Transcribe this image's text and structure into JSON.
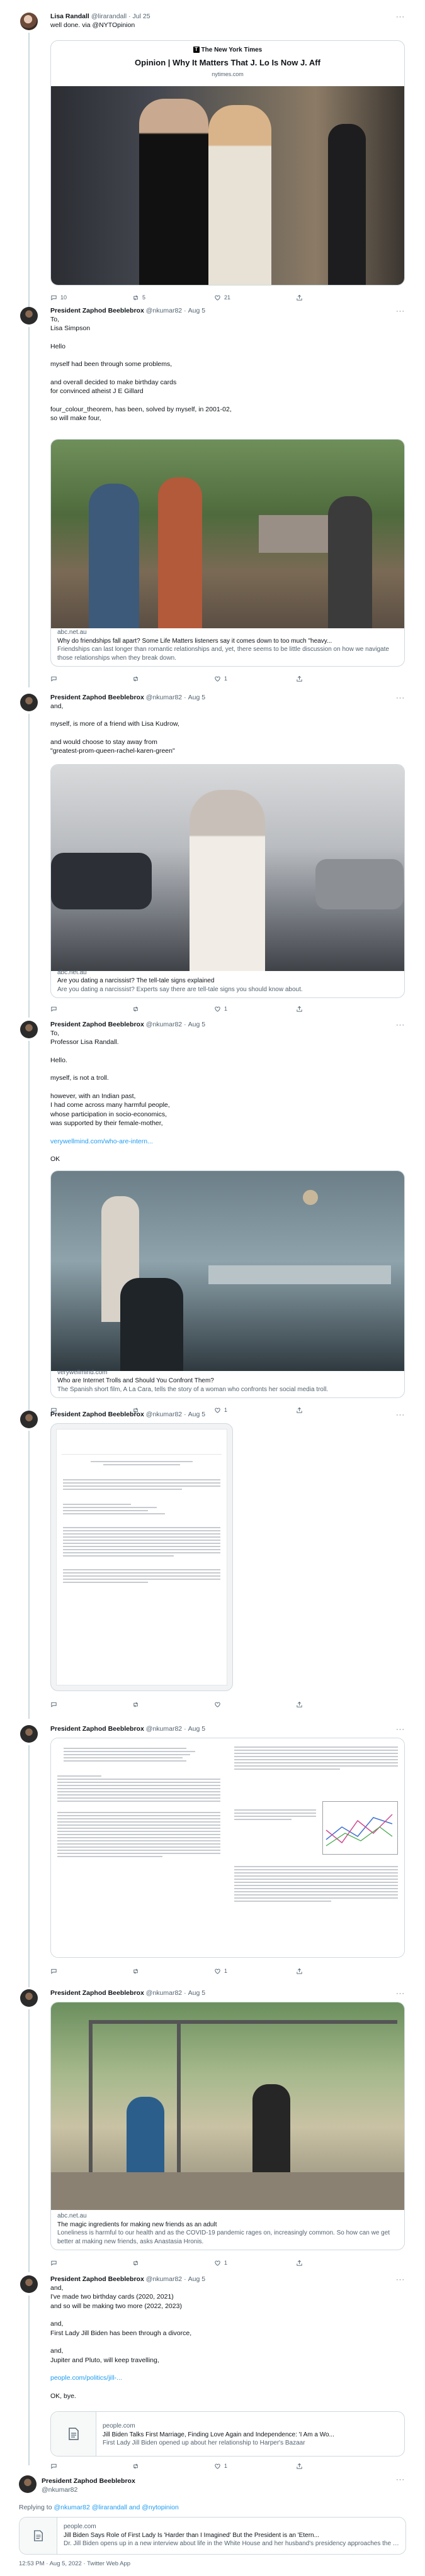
{
  "tweets": [
    {
      "name": "Lisa Randall",
      "handle": "@lirarandall",
      "date": "Jul 25",
      "lines": [
        "well done. via @NYTOpinion"
      ],
      "card": {
        "source": "The New York Times",
        "title": "Opinion | Why It Matters That J. Lo Is Now J. Aff",
        "domain": "nytimes.com"
      },
      "counts": {
        "reply": "10",
        "retweet": "5",
        "like": "21"
      }
    },
    {
      "name": "President Zaphod Beeblebrox",
      "handle": "@nkumar82",
      "date": "Aug 5",
      "lines": [
        "To,",
        "Lisa Simpson",
        "",
        "Hello",
        "",
        "myself had been through some problems,",
        "",
        "and overall decided to make birthday cards",
        "for convinced atheist J E Gillard",
        "",
        "four_colour_theorem, has been, solved by myself, in 2001-02,",
        "so will make four,"
      ],
      "card": {
        "domain": "abc.net.au",
        "title": "Why do friendships fall apart? Some Life Matters listeners say it comes down to too much \"heavy...",
        "desc": "Friendships can last longer than romantic relationships and, yet, there seems to be little discussion on how we navigate those relationships when they break down."
      },
      "counts": {
        "reply": "",
        "retweet": "",
        "like": "1"
      }
    },
    {
      "name": "President Zaphod Beeblebrox",
      "handle": "@nkumar82",
      "date": "Aug 5",
      "lines": [
        "and,",
        "",
        "myself, is more of a friend with Lisa Kudrow,",
        "",
        "and would choose to stay away from",
        "\"greatest-prom-queen-rachel-karen-green\""
      ],
      "card": {
        "domain": "abc.net.au",
        "title": "Are you dating a narcissist? The tell-tale signs explained",
        "desc": "Are you dating a narcissist? Experts say there are tell-tale signs you should know about."
      },
      "counts": {
        "reply": "",
        "retweet": "",
        "like": "1"
      }
    },
    {
      "name": "President Zaphod Beeblebrox",
      "handle": "@nkumar82",
      "date": "Aug 5",
      "lines": [
        "To,",
        "Professor Lisa Randall.",
        "",
        "Hello.",
        "",
        "myself, is not a troll.",
        "",
        "however, with an Indian past,",
        "I had come across many harmful people,",
        "whose participation in socio-economics,",
        "was supported by their female-mother,"
      ],
      "link": "verywellmind.com/who-are-intern...",
      "after": [
        "OK"
      ],
      "card": {
        "domain": "verywellmind.com",
        "title": "Who are Internet Trolls and Should You Confront Them?",
        "desc": "The Spanish short film, A La Cara, tells the story of a woman who confronts her social media troll."
      },
      "counts": {
        "reply": "",
        "retweet": "",
        "like": "1"
      }
    },
    {
      "name": "President Zaphod Beeblebrox",
      "handle": "@nkumar82",
      "date": "Aug 5",
      "counts": {
        "reply": "",
        "retweet": "",
        "like": ""
      }
    },
    {
      "name": "President Zaphod Beeblebrox",
      "handle": "@nkumar82",
      "date": "Aug 5",
      "counts": {
        "reply": "",
        "retweet": "",
        "like": "1"
      }
    },
    {
      "name": "President Zaphod Beeblebrox",
      "handle": "@nkumar82",
      "date": "Aug 5",
      "card": {
        "domain": "abc.net.au",
        "title": "The magic ingredients for making new friends as an adult",
        "desc": "Loneliness is harmful to our health and as the COVID-19 pandemic rages on, increasingly common. So how can we get better at making new friends, asks Anastasia Hronis."
      },
      "counts": {
        "reply": "",
        "retweet": "",
        "like": "1"
      }
    },
    {
      "name": "President Zaphod Beeblebrox",
      "handle": "@nkumar82",
      "date": "Aug 5",
      "lines": [
        "and,",
        "I've made two birthday cards (2020, 2021)",
        "and so will be making two more (2022, 2023)",
        "",
        "and,",
        "First Lady Jill Biden has been through a divorce,",
        "",
        "and,",
        "Jupiter and Pluto, will keep travelling,"
      ],
      "link": "people.com/politics/jill-...",
      "after": [
        "OK, bye."
      ],
      "card": {
        "domain": "people.com",
        "title": "Jill Biden Talks First Marriage, Finding Love Again and Independence: 'I Am a Wo...",
        "desc": "First Lady Jill Biden opened up about her relationship to Harper's Bazaar"
      },
      "counts": {
        "reply": "",
        "retweet": "",
        "like": "1"
      }
    }
  ],
  "main": {
    "name": "President Zaphod Beeblebrox",
    "handle": "@nkumar82",
    "replying_prefix": "Replying to",
    "replying_to": "@nkumar82 @lirarandall and @nytopinion",
    "card": {
      "domain": "people.com",
      "title": "Jill Biden Says Role of First Lady Is 'Harder than I Imagined' But the President is an 'Etern...",
      "desc": "Dr. Jill Biden opens up in a new interview about life in the White House and her husband's presidency approaches the end of a challenging first year"
    },
    "timestamp": "12:53 PM · Aug 5, 2022 · Twitter Web App"
  },
  "colors": {
    "link": "#1d9bf0",
    "muted": "#536471",
    "border": "#cfd9de"
  },
  "icons": [
    "reply-icon",
    "retweet-icon",
    "like-icon",
    "share-icon",
    "more-icon",
    "link-card-icon"
  ]
}
